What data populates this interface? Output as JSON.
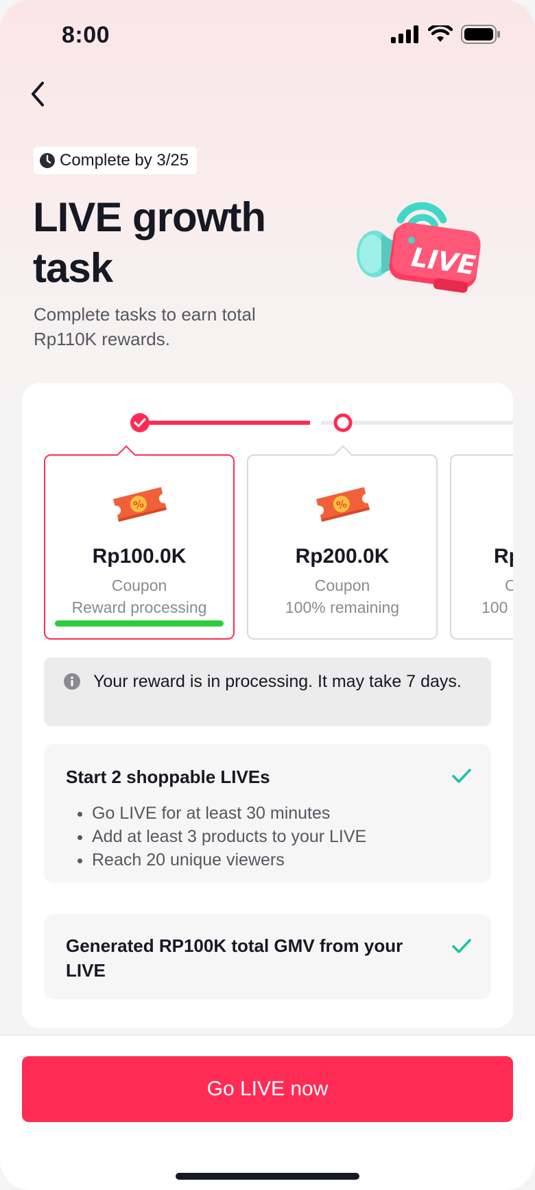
{
  "status_bar": {
    "time": "8:00"
  },
  "header": {
    "deadline": "Complete by 3/25",
    "title": "LIVE growth task",
    "subtitle": "Complete tasks to earn total Rp110K rewards.",
    "hero_badge_text": "LIVE"
  },
  "tiers": [
    {
      "amount": "Rp100.0K",
      "type": "Coupon",
      "state": "Reward processing",
      "status": "completed"
    },
    {
      "amount": "Rp200.0K",
      "type": "Coupon",
      "state": "100% remaining",
      "status": "current"
    },
    {
      "amount": "Rp",
      "type": "C",
      "state": "100",
      "status": "upcoming"
    }
  ],
  "notice": {
    "text": "Your reward is in processing. It may take 7 days."
  },
  "tasks": [
    {
      "title": "Start 2 shoppable LIVEs",
      "done": true,
      "requirements": [
        "Go LIVE for at least 30 minutes",
        "Add at least 3 products to your LIVE",
        "Reach 20 unique viewers"
      ]
    },
    {
      "title": "Generated RP100K total GMV from your LIVE",
      "done": true,
      "requirements": []
    }
  ],
  "cta": {
    "label": "Go LIVE now"
  },
  "colors": {
    "accent": "#fe2c55",
    "success_check": "#20c0a8",
    "progress_done": "#2ecc3a",
    "coupon": "#f2603a"
  }
}
